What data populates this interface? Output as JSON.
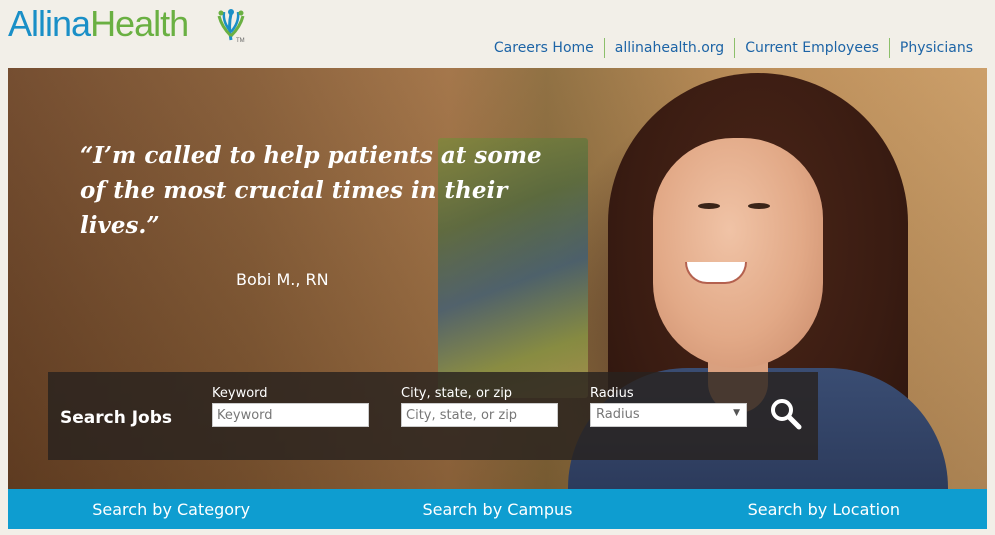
{
  "brand": {
    "name_part1": "Allina",
    "name_part2": "Health",
    "trademark": "TM"
  },
  "topnav": [
    {
      "label": "Careers Home"
    },
    {
      "label": "allinahealth.org"
    },
    {
      "label": "Current Employees"
    },
    {
      "label": "Physicians"
    }
  ],
  "hero": {
    "quote": "“I’m called to help patients at some of the most crucial times in their lives.”",
    "author": "Bobi M., RN"
  },
  "search": {
    "title": "Search Jobs",
    "keyword": {
      "label": "Keyword",
      "placeholder": "Keyword"
    },
    "location": {
      "label": "City, state, or zip",
      "placeholder": "City, state, or zip"
    },
    "radius": {
      "label": "Radius",
      "selected": "Radius"
    },
    "search_icon": "search-icon"
  },
  "bottomnav": [
    {
      "label": "Search by Category"
    },
    {
      "label": "Search by Campus"
    },
    {
      "label": "Search by Location"
    }
  ],
  "colors": {
    "brand_blue": "#1a8fc7",
    "brand_green": "#6ab042",
    "nav_link": "#1d64a6",
    "bottom_bar": "#0e9dd0"
  }
}
